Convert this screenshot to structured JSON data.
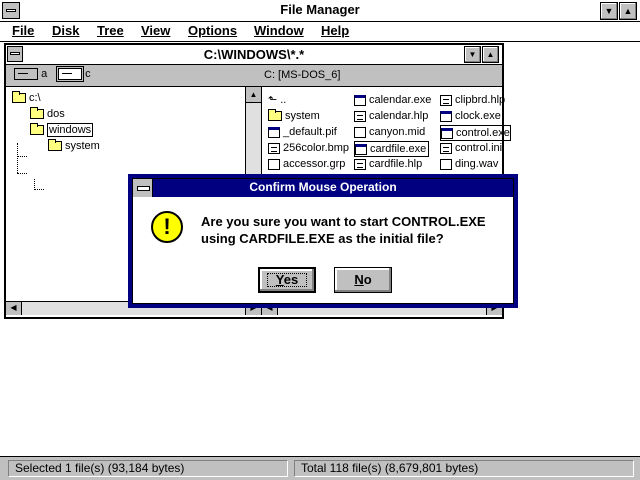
{
  "app": {
    "title": "File Manager"
  },
  "menu": {
    "items": [
      "File",
      "Disk",
      "Tree",
      "View",
      "Options",
      "Window",
      "Help"
    ]
  },
  "dir_window": {
    "title": "C:\\WINDOWS\\*.*",
    "drives": [
      {
        "letter": "a",
        "selected": false
      },
      {
        "letter": "c",
        "selected": true
      }
    ],
    "volume_label": "C: [MS-DOS_6]",
    "tree": [
      {
        "name": "c:\\",
        "level": 0
      },
      {
        "name": "dos",
        "level": 1
      },
      {
        "name": "windows",
        "level": 1,
        "selected": true
      },
      {
        "name": "system",
        "level": 2
      }
    ],
    "files_col1": [
      {
        "name": "..",
        "icon": "up-arrow"
      },
      {
        "name": "system",
        "icon": "folder"
      },
      {
        "name": "_default.pif",
        "icon": "doc"
      },
      {
        "name": "256color.bmp",
        "icon": "doc"
      },
      {
        "name": "accessor.grp",
        "icon": "file"
      }
    ],
    "files_col2": [
      {
        "name": "calendar.exe",
        "icon": "exe"
      },
      {
        "name": "calendar.hlp",
        "icon": "doc"
      },
      {
        "name": "canyon.mid",
        "icon": "file"
      },
      {
        "name": "cardfile.exe",
        "icon": "exe",
        "selected": true
      },
      {
        "name": "cardfile.hlp",
        "icon": "doc"
      }
    ],
    "files_col3": [
      {
        "name": "clipbrd.hlp",
        "icon": "doc"
      },
      {
        "name": "clock.exe",
        "icon": "exe"
      },
      {
        "name": "control.exe",
        "icon": "exe",
        "focused": true
      },
      {
        "name": "control.ini",
        "icon": "doc"
      },
      {
        "name": "ding.wav",
        "icon": "file"
      }
    ]
  },
  "dialog": {
    "title": "Confirm Mouse Operation",
    "line1": "Are you sure you want to start CONTROL.EXE",
    "line2": "using CARDFILE.EXE as the initial file?",
    "yes_label_mnemonic": "Y",
    "yes_label_rest": "es",
    "no_label_mnemonic": "N",
    "no_label_rest": "o",
    "icon": "exclamation-icon",
    "icon_glyph": "!"
  },
  "status": {
    "left": "Selected 1 file(s) (93,184 bytes)",
    "right": "Total 118 file(s) (8,679,801 bytes)"
  },
  "colors": {
    "title_active": "#000080",
    "face": "#c0c0c0",
    "folder": "#ffff80",
    "warning": "#ffff00"
  }
}
